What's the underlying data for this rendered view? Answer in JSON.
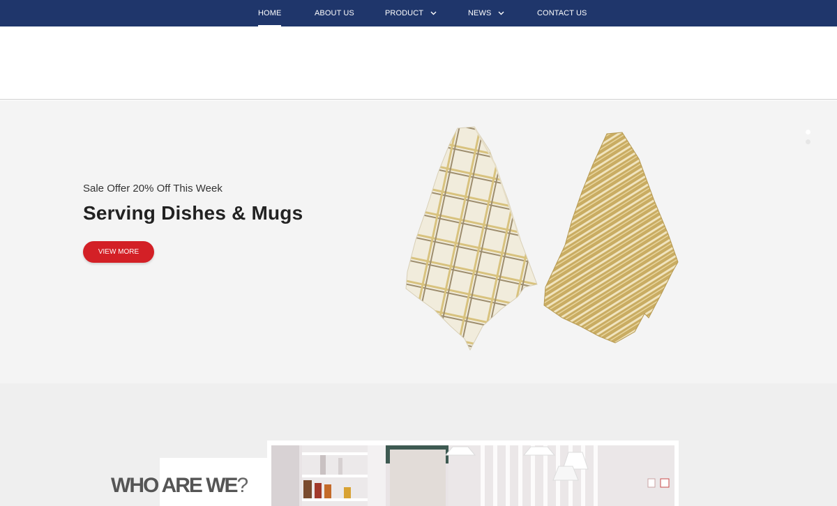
{
  "nav": {
    "items": [
      {
        "label": "HOME",
        "has_dropdown": false,
        "active": true
      },
      {
        "label": "ABOUT US",
        "has_dropdown": false,
        "active": false
      },
      {
        "label": "PRODUCT",
        "has_dropdown": true,
        "active": false
      },
      {
        "label": "NEWS",
        "has_dropdown": true,
        "active": false
      },
      {
        "label": "CONTACT US",
        "has_dropdown": false,
        "active": false
      }
    ]
  },
  "hero": {
    "subtitle": "Sale Offer 20% Off This Week",
    "title": "Serving Dishes & Mugs",
    "button_label": "VIEW MORE"
  },
  "about": {
    "title": "WHO ARE WE",
    "title_mark": "?"
  },
  "colors": {
    "nav_bg": "#1f366b",
    "button_red": "#d32026",
    "hero_bg": "#f4f4f4",
    "about_bg": "#efefef"
  },
  "icons": [
    "chevron-down-icon"
  ]
}
